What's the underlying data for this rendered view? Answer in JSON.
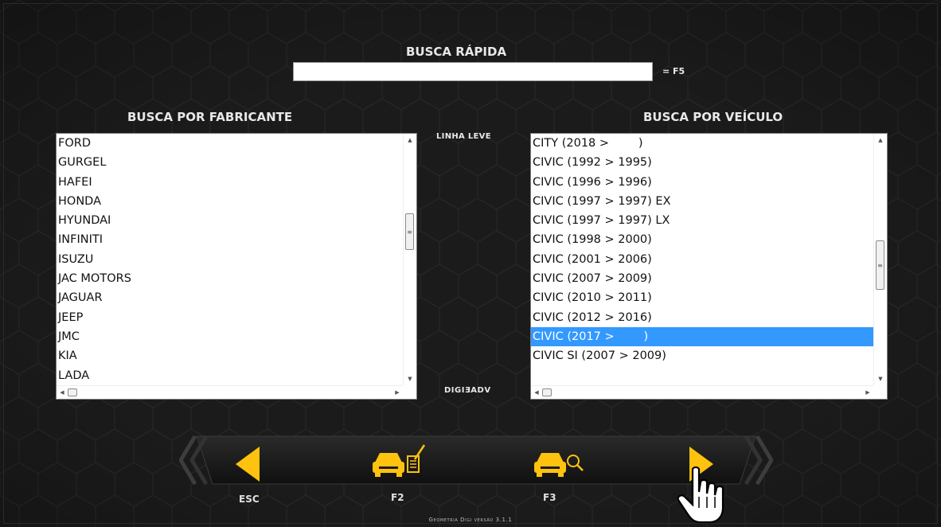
{
  "quick_search": {
    "title": "BUSCA RÁPIDA",
    "value": "",
    "shortcut_hint": "= F5"
  },
  "manufacturer": {
    "title": "BUSCA POR FABRICANTE",
    "items": [
      "FORD",
      "GURGEL",
      "HAFEI",
      "HONDA",
      "HYUNDAI",
      "INFINITI",
      "ISUZU",
      "JAC MOTORS",
      "JAGUAR",
      "JEEP",
      "JMC",
      "KIA",
      "LADA"
    ]
  },
  "center": {
    "line_label": "LINHA LEVE",
    "brand_label": "DIGIƎADV"
  },
  "vehicle": {
    "title": "BUSCA POR VEÍCULO",
    "items": [
      "CITY (2018 >        )",
      "CIVIC (1992 > 1995)",
      "CIVIC (1996 > 1996)",
      "CIVIC (1997 > 1997) EX",
      "CIVIC (1997 > 1997) LX",
      "CIVIC (1998 > 2000)",
      "CIVIC (2001 > 2006)",
      "CIVIC (2007 > 2009)",
      "CIVIC (2010 > 2011)",
      "CIVIC (2012 > 2016)",
      "CIVIC (2017 >        )",
      "CIVIC SI (2007 > 2009)"
    ],
    "selected": "CIVIC (2017 >        )"
  },
  "buttons": {
    "esc_label": "ESC",
    "f2_label": "F2",
    "f3_label": "F3"
  },
  "icons": {
    "back": "back-arrow-icon",
    "f2": "car-edit-icon",
    "f3": "car-search-icon",
    "next": "next-arrow-icon",
    "cursor": "hand-pointer-icon"
  },
  "colors": {
    "accent": "#ffc20e",
    "selection": "#3399ff",
    "background": "#1b1b1b"
  },
  "footer": "Geometria Digi versão 3.1.1"
}
